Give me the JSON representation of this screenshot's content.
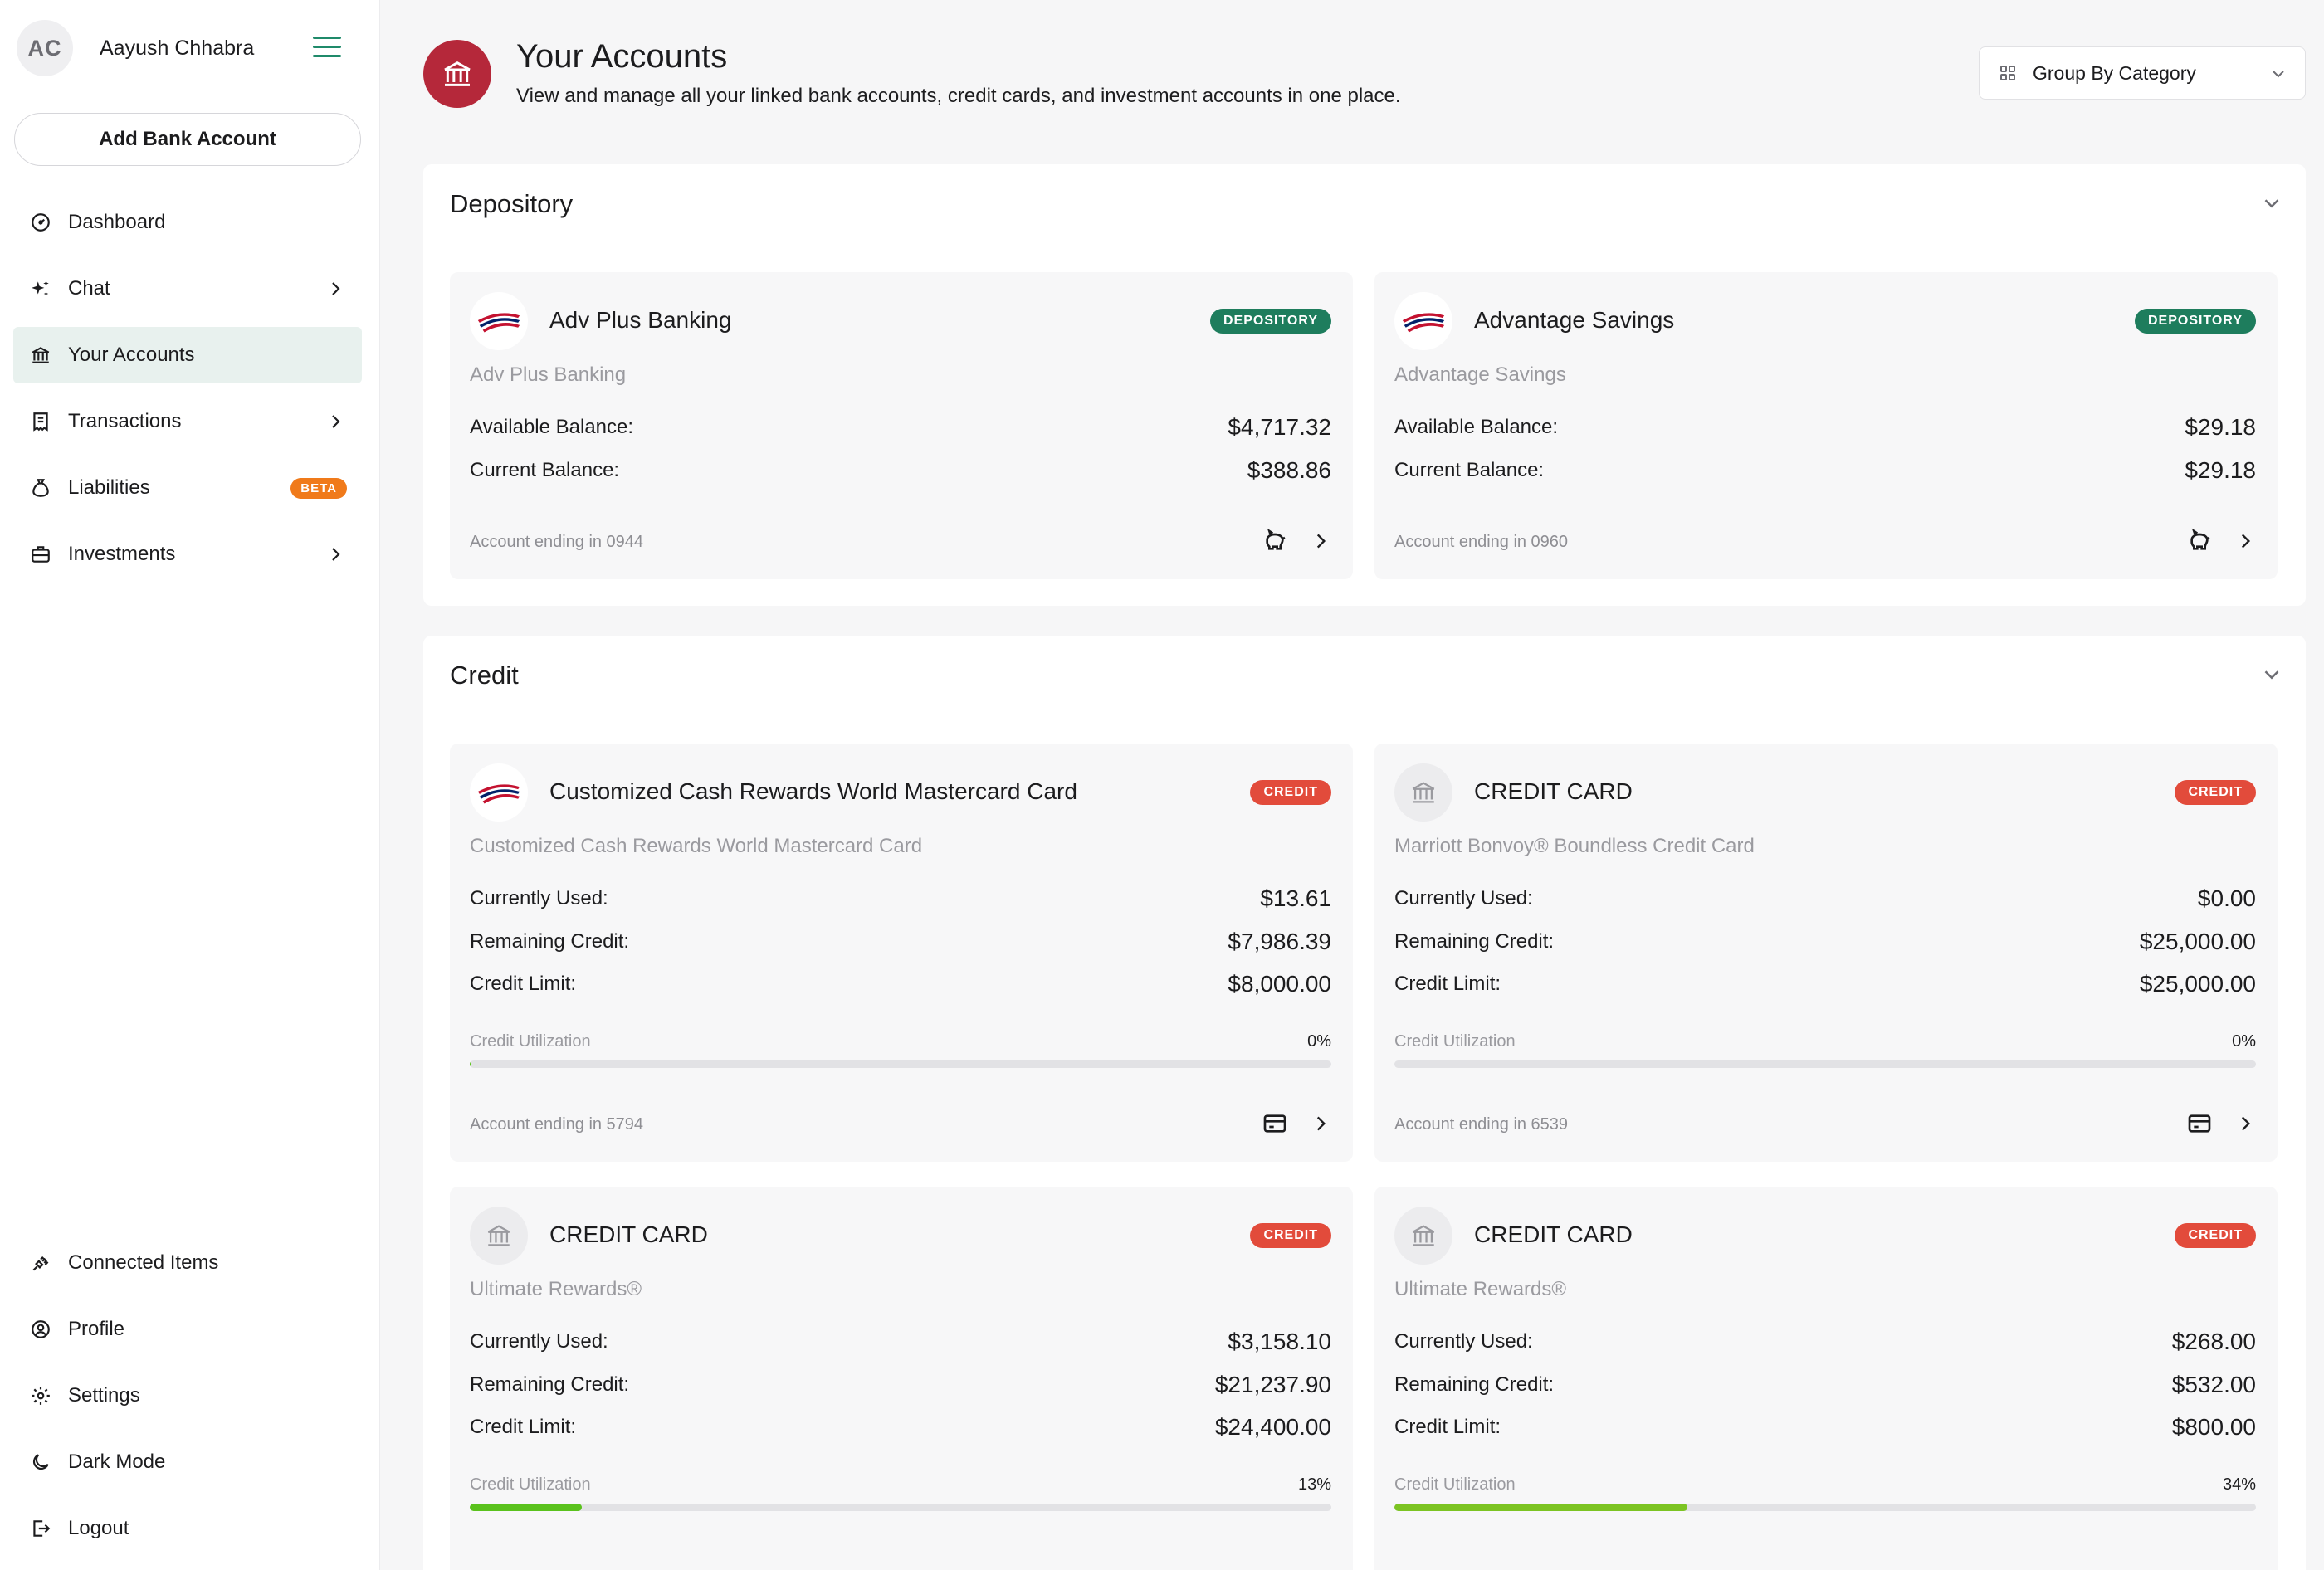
{
  "user": {
    "initials": "AC",
    "name": "Aayush Chhabra"
  },
  "sidebar": {
    "add_bank": "Add Bank Account",
    "items": [
      {
        "label": "Dashboard"
      },
      {
        "label": "Chat"
      },
      {
        "label": "Your Accounts"
      },
      {
        "label": "Transactions"
      },
      {
        "label": "Liabilities",
        "badge": "BETA"
      },
      {
        "label": "Investments"
      }
    ],
    "bottom": [
      {
        "label": "Connected Items"
      },
      {
        "label": "Profile"
      },
      {
        "label": "Settings"
      },
      {
        "label": "Dark Mode"
      },
      {
        "label": "Logout"
      }
    ]
  },
  "header": {
    "title": "Your Accounts",
    "subtitle": "View and manage all your linked bank accounts, credit cards, and investment accounts in one place.",
    "group_by": "Group By Category"
  },
  "sections": {
    "depository": {
      "title": "Depository",
      "cards": [
        {
          "name": "Adv Plus Banking",
          "badge": "DEPOSITORY",
          "sub": "Adv Plus Banking",
          "rows": [
            {
              "label": "Available Balance:",
              "value": "$4,717.32"
            },
            {
              "label": "Current Balance:",
              "value": "$388.86"
            }
          ],
          "ending": "Account ending in 0944"
        },
        {
          "name": "Advantage Savings",
          "badge": "DEPOSITORY",
          "sub": "Advantage Savings",
          "rows": [
            {
              "label": "Available Balance:",
              "value": "$29.18"
            },
            {
              "label": "Current Balance:",
              "value": "$29.18"
            }
          ],
          "ending": "Account ending in 0960"
        }
      ]
    },
    "credit": {
      "title": "Credit",
      "cards": [
        {
          "name": "Customized Cash Rewards World Mastercard Card",
          "badge": "CREDIT",
          "sub": "Customized Cash Rewards World Mastercard Card",
          "rows": [
            {
              "label": "Currently Used:",
              "value": "$13.61"
            },
            {
              "label": "Remaining Credit:",
              "value": "$7,986.39"
            },
            {
              "label": "Credit Limit:",
              "value": "$8,000.00"
            }
          ],
          "util_label": "Credit Utilization",
          "util_pct": "0%",
          "util_value": 0.2,
          "ending": "Account ending in 5794"
        },
        {
          "name": "CREDIT CARD",
          "badge": "CREDIT",
          "sub": "Marriott Bonvoy® Boundless Credit Card",
          "rows": [
            {
              "label": "Currently Used:",
              "value": "$0.00"
            },
            {
              "label": "Remaining Credit:",
              "value": "$25,000.00"
            },
            {
              "label": "Credit Limit:",
              "value": "$25,000.00"
            }
          ],
          "util_label": "Credit Utilization",
          "util_pct": "0%",
          "util_value": 0,
          "ending": "Account ending in 6539"
        },
        {
          "name": "CREDIT CARD",
          "badge": "CREDIT",
          "sub": "Ultimate Rewards®",
          "rows": [
            {
              "label": "Currently Used:",
              "value": "$3,158.10"
            },
            {
              "label": "Remaining Credit:",
              "value": "$21,237.90"
            },
            {
              "label": "Credit Limit:",
              "value": "$24,400.00"
            }
          ],
          "util_label": "Credit Utilization",
          "util_pct": "13%",
          "util_value": 13
        },
        {
          "name": "CREDIT CARD",
          "badge": "CREDIT",
          "sub": "Ultimate Rewards®",
          "rows": [
            {
              "label": "Currently Used:",
              "value": "$268.00"
            },
            {
              "label": "Remaining Credit:",
              "value": "$532.00"
            },
            {
              "label": "Credit Limit:",
              "value": "$800.00"
            }
          ],
          "util_label": "Credit Utilization",
          "util_pct": "34%",
          "util_value": 34
        }
      ]
    }
  },
  "colors": {
    "accent": "#1f8a6a",
    "brand_icon": "#b5283a",
    "depository_badge": "#1e7d5d",
    "credit_badge": "#e24b3b",
    "util_low": "#5ac21d",
    "util_mid": "#7cc423"
  }
}
